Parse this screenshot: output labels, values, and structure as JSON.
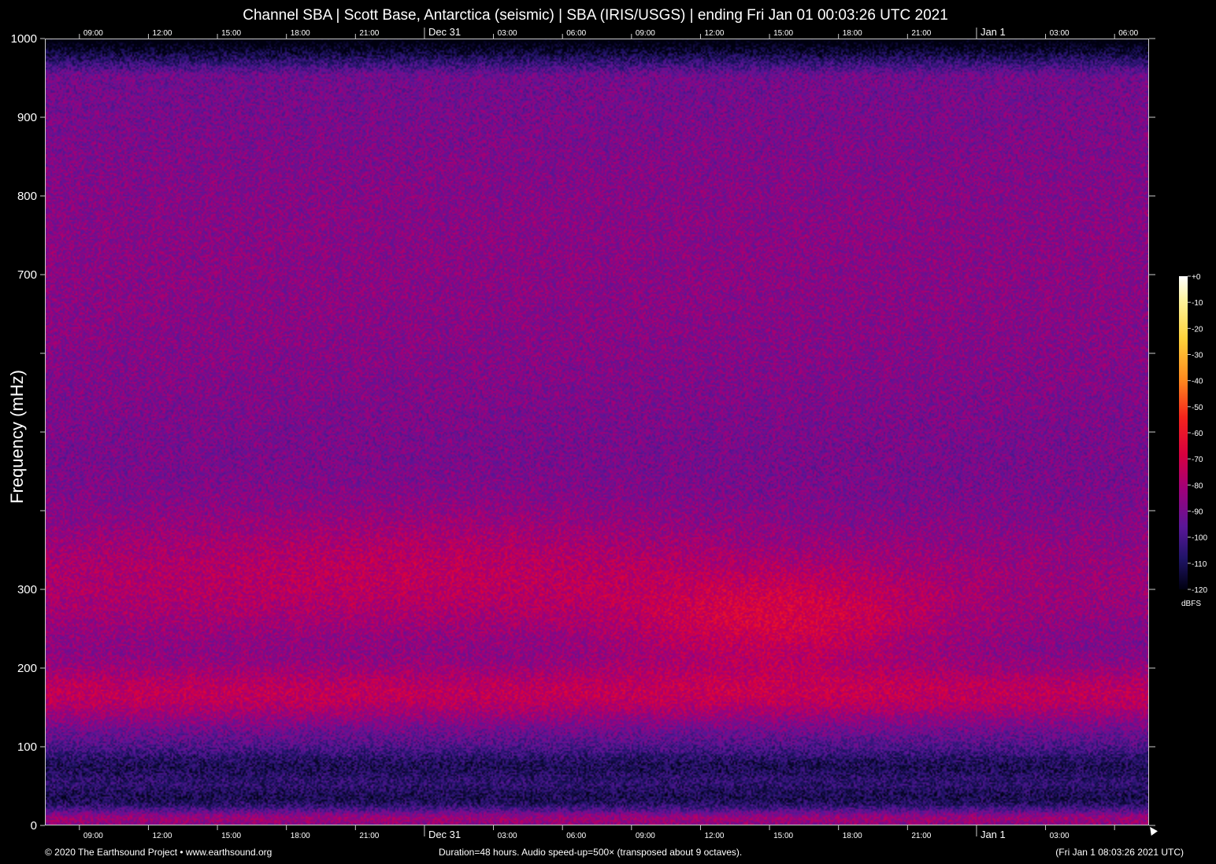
{
  "chart_data": {
    "type": "heatmap",
    "title": "Channel SBA | Scott Base, Antarctica (seismic) | SBA (IRIS/USGS) | ending Fri Jan 01 00:03:26 UTC 2021",
    "ylabel": "Frequency (mHz)",
    "xlabel": "",
    "ylim": [
      0,
      1000
    ],
    "y_ticks": [
      0,
      100,
      200,
      300,
      400,
      500,
      600,
      700,
      800,
      900,
      1000
    ],
    "y_tick_labels": [
      "0",
      "100",
      "200",
      "300",
      "",
      "",
      "",
      "700",
      "800",
      "900",
      "1000"
    ],
    "x_range_hours": [
      0,
      48
    ],
    "x_tick_labels": [
      {
        "hour": 1.5,
        "label": "09:00",
        "major": false
      },
      {
        "hour": 4.5,
        "label": "12:00",
        "major": false
      },
      {
        "hour": 7.5,
        "label": "15:00",
        "major": false
      },
      {
        "hour": 10.5,
        "label": "18:00",
        "major": false
      },
      {
        "hour": 13.5,
        "label": "21:00",
        "major": false
      },
      {
        "hour": 16.5,
        "label": "Dec 31",
        "major": true
      },
      {
        "hour": 19.5,
        "label": "03:00",
        "major": false
      },
      {
        "hour": 22.5,
        "label": "06:00",
        "major": false
      },
      {
        "hour": 25.5,
        "label": "09:00",
        "major": false
      },
      {
        "hour": 28.5,
        "label": "12:00",
        "major": false
      },
      {
        "hour": 31.5,
        "label": "15:00",
        "major": false
      },
      {
        "hour": 34.5,
        "label": "18:00",
        "major": false
      },
      {
        "hour": 37.5,
        "label": "21:00",
        "major": false
      },
      {
        "hour": 40.5,
        "label": "Jan  1",
        "major": true
      },
      {
        "hour": 43.5,
        "label": "03:00",
        "major": false
      },
      {
        "hour": 46.5,
        "label": "06:00",
        "major": false
      }
    ],
    "bottom_tick_labels_omit": [
      "06:00"
    ],
    "colorbar": {
      "unit": "dBFS",
      "ticks": [
        "+0",
        "-10",
        "-20",
        "-30",
        "-40",
        "-50",
        "-60",
        "-70",
        "-80",
        "-90",
        "-100",
        "-110",
        "-120"
      ],
      "range": [
        -120,
        0
      ]
    },
    "features": [
      {
        "name": "microseism band",
        "freq_center_mHz": 165,
        "level_dBFS": -70
      },
      {
        "name": "broad energy",
        "freq_center_mHz": 290,
        "level_dBFS": -72
      },
      {
        "name": "low-frequency dark band",
        "freq_center_mHz": 35,
        "level_dBFS": -105
      },
      {
        "name": "near-zero band",
        "freq_center_mHz": 10,
        "level_dBFS": -78
      },
      {
        "name": "high-frequency background",
        "freq_center_mHz": 850,
        "level_dBFS": -95
      }
    ]
  },
  "footer": {
    "left": "© 2020 The Earthsound Project • www.earthsound.org",
    "center": "Duration=48 hours. Audio speed-up=500× (transposed about 9 octaves).",
    "right": "(Fri Jan  1 08:03:26 2021 UTC)"
  },
  "colors": {
    "background": "#000000",
    "axis": "#cccccc",
    "text": "#ffffff"
  },
  "icons": {
    "cursor": "pointer-arrow-icon"
  }
}
